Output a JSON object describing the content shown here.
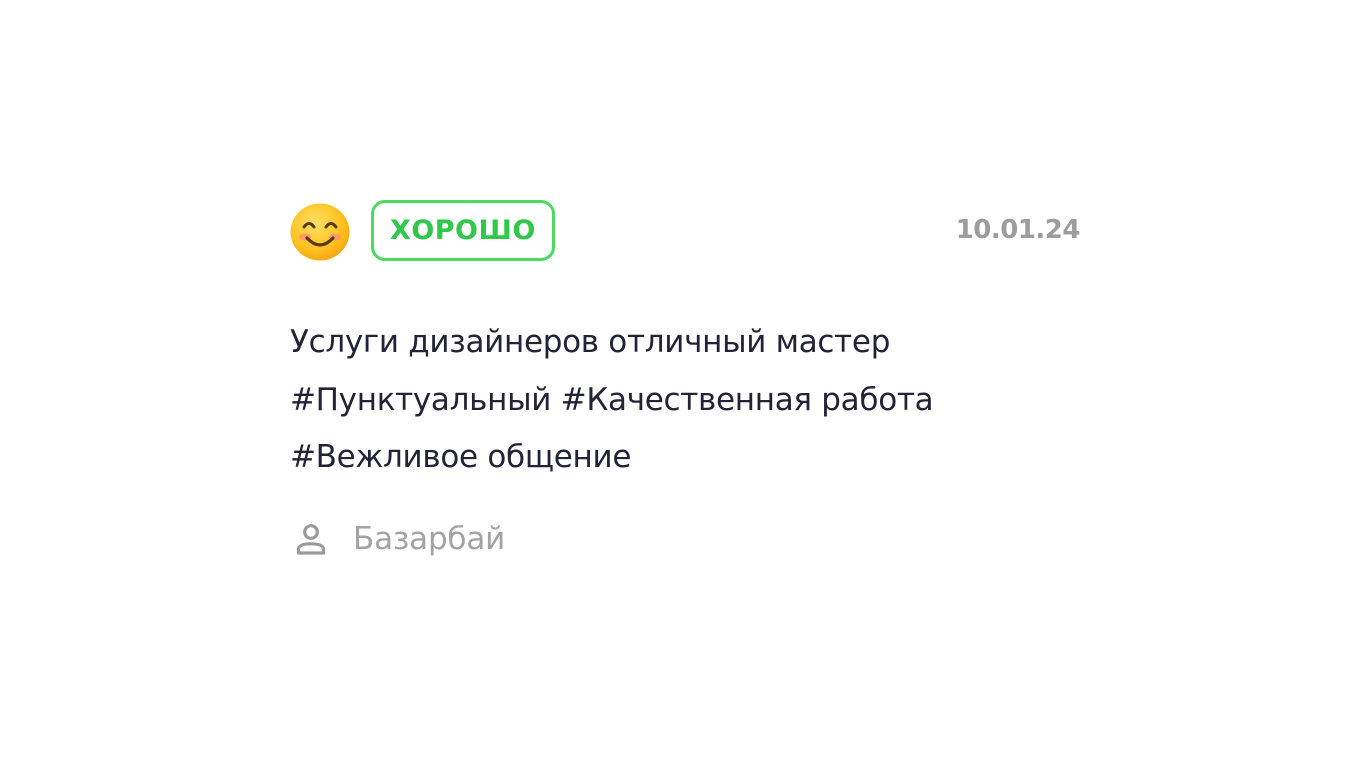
{
  "review": {
    "mood_icon": "smiling-face-emoji",
    "rating_label": "ХОРОШО",
    "date": "10.01.24",
    "text": "Услуги дизайнеров отличный мастер #Пунктуальный #Качественная работа #Вежливое общение",
    "author_icon": "person-icon",
    "author_name": "Базарбай"
  },
  "colors": {
    "badge_green": "#4cd964",
    "text_dark": "#232338",
    "muted_gray": "#9d9d9d"
  }
}
